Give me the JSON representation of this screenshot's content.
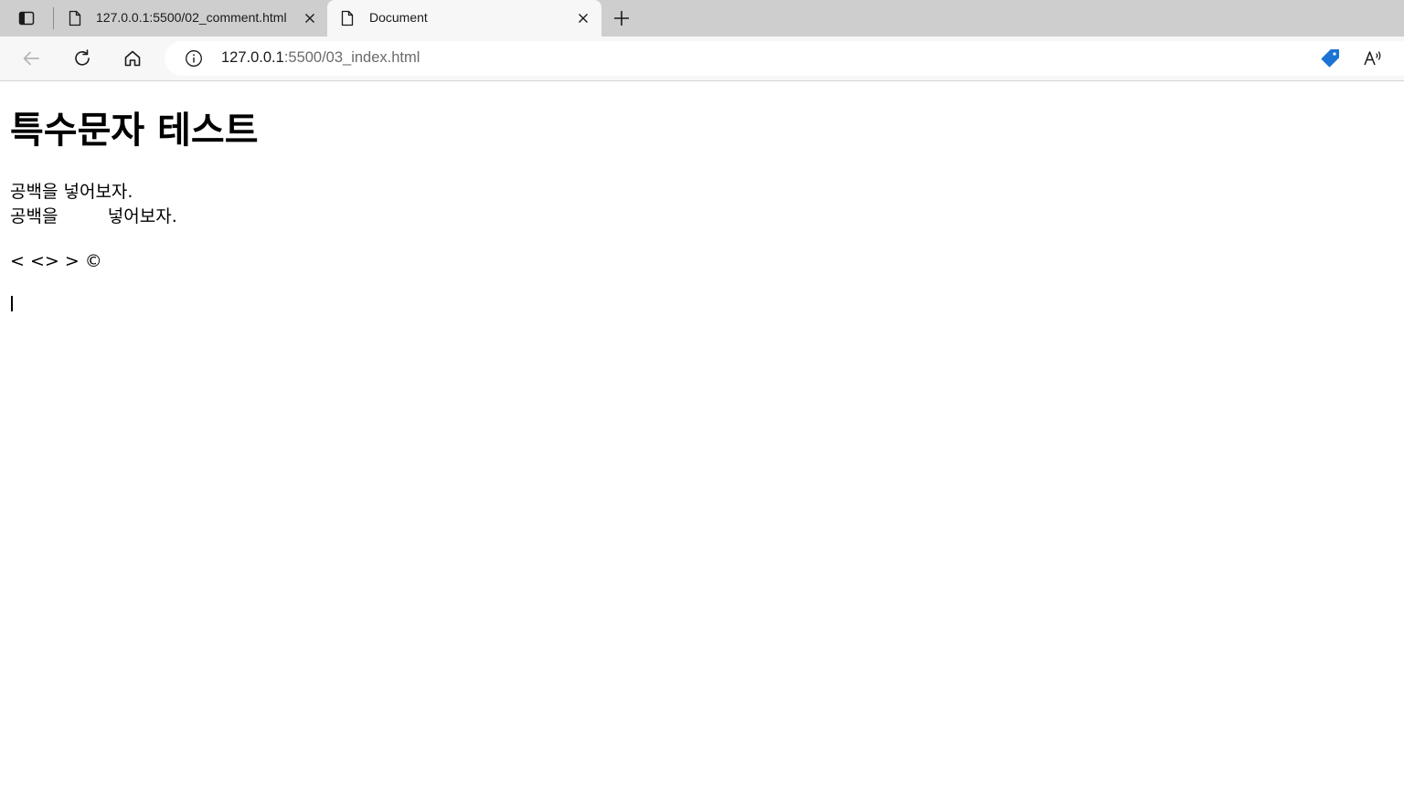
{
  "browser": {
    "tabs": [
      {
        "title": "127.0.0.1:5500/02_comment.html",
        "active": false
      },
      {
        "title": "Document",
        "active": true
      }
    ],
    "address": {
      "host": "127.0.0.1",
      "path": ":5500/03_index.html"
    },
    "icons": {
      "tab_actions": "tab-actions-icon",
      "page": "page-icon",
      "close": "close-icon",
      "new_tab": "plus-icon",
      "back": "back-arrow-icon",
      "refresh": "refresh-icon",
      "home": "home-icon",
      "site_info": "info-icon",
      "shopping": "tag-icon",
      "read_aloud": "read-aloud-icon"
    },
    "colors": {
      "tabbar": "#cecece",
      "toolbar": "#f7f7f7",
      "tag_icon": "#1b74d4"
    }
  },
  "page": {
    "heading": "특수문자 테스트",
    "line1": "공백을 넣어보자.",
    "line2": "공백을         넣어보자.",
    "special_chars": "< <> > ©"
  }
}
